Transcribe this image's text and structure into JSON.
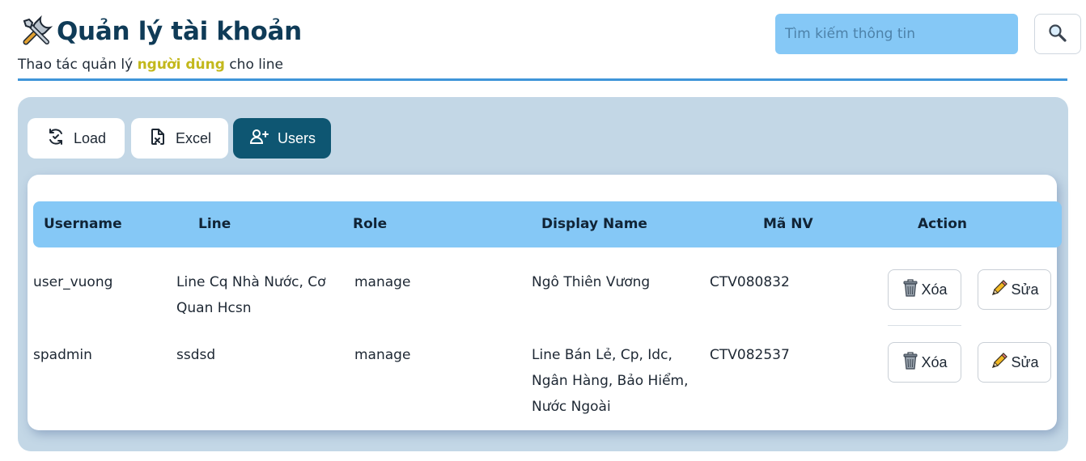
{
  "header": {
    "title": "Quản lý tài khoản",
    "subtitle_pre": "Thao tác quản lý ",
    "subtitle_highlight": "người dùng",
    "subtitle_post": " cho line",
    "title_icon": "tools-icon"
  },
  "search": {
    "placeholder": "Tìm kiếm thông tin",
    "value": "",
    "button_icon": "magnifier-icon"
  },
  "toolbar": {
    "load_label": "Load",
    "excel_label": "Excel",
    "users_label": "Users"
  },
  "table": {
    "columns": [
      "Username",
      "Line",
      "Role",
      "Display Name",
      "Mã NV",
      "Action"
    ],
    "rows": [
      {
        "username": "user_vuong",
        "line": [
          "Line Cq Nhà Nước, Cơ",
          "Quan Hcsn"
        ],
        "role": "manage",
        "display_name": [
          "Ngô Thiên Vương"
        ],
        "employee_id": "CTV080832",
        "delete_label": "Xóa",
        "edit_label": "Sửa"
      },
      {
        "username": "spadmin",
        "line": [
          "ssdsd"
        ],
        "role": "manage",
        "display_name": [
          "Line Bán Lẻ, Cp, Idc,",
          "Ngân Hàng, Bảo Hiểm,",
          "Nước Ngoài"
        ],
        "employee_id": "CTV082537",
        "delete_label": "Xóa",
        "edit_label": "Sửa"
      }
    ]
  },
  "colors": {
    "title": "#0f3b57",
    "highlight": "#c3b81c",
    "accent_line": "#3f95d9",
    "header_bg": "#85c8f6",
    "panel_bg": "#c3d7e6",
    "primary_button": "#0e5672"
  }
}
